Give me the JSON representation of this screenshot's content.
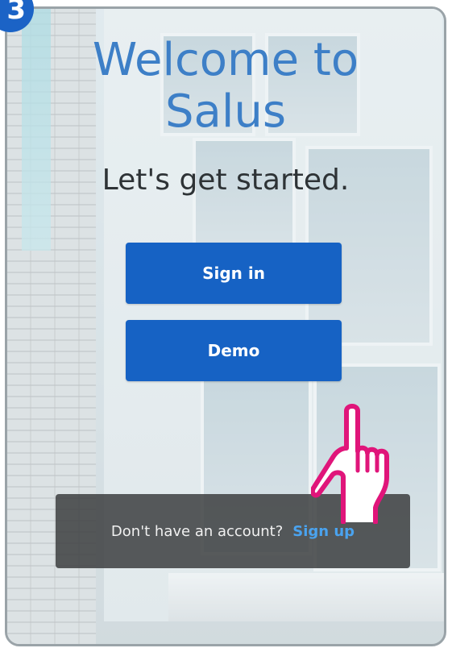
{
  "step": {
    "number": "3"
  },
  "welcome": {
    "line1": "Welcome to",
    "line2": "Salus"
  },
  "subtitle": "Let's get started.",
  "buttons": {
    "signin_label": "Sign in",
    "demo_label": "Demo"
  },
  "signup_bar": {
    "prompt": "Don't have an account?",
    "link_label": "Sign up"
  },
  "colors": {
    "primary": "#1662c4",
    "title": "#3d7fc7",
    "link": "#4aa3ef",
    "pointer": "#e0157a"
  },
  "icons": {
    "pointer": "hand-pointer-icon"
  }
}
